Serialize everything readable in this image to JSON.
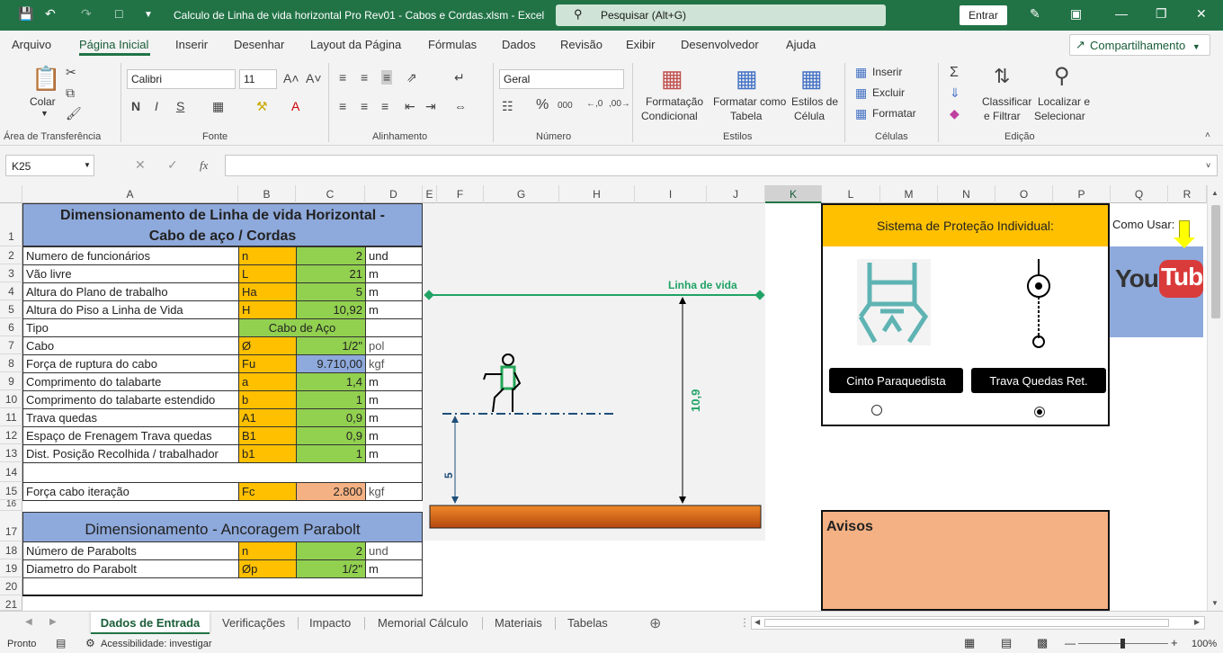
{
  "titlebar": {
    "file_title": "Calculo de Linha de vida horizontal  Pro Rev01 - Cabos e Cordas.xlsm  -  Excel",
    "search_placeholder": "Pesquisar (Alt+G)",
    "signin_label": "Entrar"
  },
  "menu": {
    "items": [
      "Arquivo",
      "Página Inicial",
      "Inserir",
      "Desenhar",
      "Layout da Página",
      "Fórmulas",
      "Dados",
      "Revisão",
      "Exibir",
      "Desenvolvedor",
      "Ajuda"
    ],
    "active": "Página Inicial",
    "share_label": "Compartilhamento"
  },
  "ribbon": {
    "clipboard": {
      "paste_label": "Colar",
      "group_label": "Área de Transferência"
    },
    "font": {
      "name": "Calibri",
      "size": "11",
      "bold": "N",
      "italic": "I",
      "underline": "S",
      "group_label": "Fonte"
    },
    "alignment": {
      "group_label": "Alinhamento"
    },
    "number": {
      "format": "Geral",
      "group_label": "Número"
    },
    "styles": {
      "conditional_l1": "Formatação",
      "conditional_l2": "Condicional",
      "table_l1": "Formatar como",
      "table_l2": "Tabela",
      "cell_l1": "Estilos de",
      "cell_l2": "Célula",
      "group_label": "Estilos"
    },
    "cells": {
      "insert": "Inserir",
      "delete": "Excluir",
      "format": "Formatar",
      "group_label": "Células"
    },
    "editing": {
      "sort_l1": "Classificar",
      "sort_l2": "e Filtrar",
      "find_l1": "Localizar e",
      "find_l2": "Selecionar",
      "group_label": "Edição"
    }
  },
  "formula_bar": {
    "name_box": "K25",
    "fx": "fx",
    "content": ""
  },
  "columns": [
    "A",
    "B",
    "C",
    "D",
    "E",
    "F",
    "G",
    "H",
    "I",
    "J",
    "K",
    "L",
    "M",
    "N",
    "O",
    "P",
    "Q",
    "R"
  ],
  "rows": [
    "1",
    "2",
    "3",
    "4",
    "5",
    "6",
    "7",
    "8",
    "9",
    "10",
    "11",
    "12",
    "13",
    "14",
    "15",
    "16",
    "17",
    "18",
    "19",
    "20",
    "21"
  ],
  "sheet": {
    "title_line1": "Dimensionamento de Linha de vida Horizontal -",
    "title_line2": "Cabo de aço  / Cordas",
    "inputs": [
      {
        "label": "Numero de funcionários",
        "sym": "n",
        "value": "2",
        "unit": "und"
      },
      {
        "label": "Vão livre",
        "sym": "L",
        "value": "21",
        "unit": "m"
      },
      {
        "label": "Altura do Plano de trabalho",
        "sym": "Ha",
        "value": "5",
        "unit": "m"
      },
      {
        "label": "Altura do Piso a Linha de Vida",
        "sym": "H",
        "value": "10,92",
        "unit": "m"
      }
    ],
    "tipo_label": "Tipo",
    "tipo_value": "Cabo de Aço",
    "cabo": {
      "label": "Cabo",
      "sym": "Ø",
      "value": "1/2\"",
      "unit": "pol"
    },
    "ruptura": {
      "label": "Força de ruptura do cabo",
      "sym": "Fu",
      "value": "9.710,00",
      "unit": "kgf"
    },
    "inputs2": [
      {
        "label": "Comprimento do talabarte",
        "sym": "a",
        "value": "1,4",
        "unit": "m"
      },
      {
        "label": "Comprimento do talabarte estendido",
        "sym": "b",
        "value": "1",
        "unit": "m"
      },
      {
        "label": "Trava quedas",
        "sym": "A1",
        "value": "0,9",
        "unit": "m"
      },
      {
        "label": "Espaço de Frenagem Trava quedas",
        "sym": "B1",
        "value": "0,9",
        "unit": "m"
      },
      {
        "label": "Dist. Posição Recolhida / trabalhador",
        "sym": "b1",
        "value": "1",
        "unit": "m"
      }
    ],
    "forca": {
      "label": "Força cabo iteração",
      "sym": "Fc",
      "value": "2.800",
      "unit": "kgf"
    },
    "ancoragem_title": "Dimensionamento - Ancoragem Parabolt",
    "parabolt": [
      {
        "label": "Número de Parabolts",
        "sym": "n",
        "value": "2",
        "unit": "und"
      },
      {
        "label": "Diametro do Parabolt",
        "sym": "Øp",
        "value": "1/2\"",
        "unit": "m"
      }
    ]
  },
  "drawing": {
    "lifeline_label": "Linha de vida",
    "height_label": "10,9",
    "work_height_label": "5"
  },
  "epi": {
    "title": "Sistema de Proteção Individual:",
    "option1": "Cinto Paraquedista",
    "option2": "Trava Quedas Ret.",
    "selected": "Trava Quedas Ret."
  },
  "how_to": {
    "label": "Como Usar:",
    "video_logo": "YouTube"
  },
  "avisos": {
    "title": "Avisos"
  },
  "tabs": {
    "items": [
      "Dados de Entrada",
      "Verificações",
      "Impacto",
      "Memorial Cálculo",
      "Materiais",
      "Tabelas"
    ],
    "active": "Dados de Entrada"
  },
  "status": {
    "ready": "Pronto",
    "accessibility": "Acessibilidade: investigar",
    "zoom": "100%"
  },
  "colors": {
    "excel_green": "#217346",
    "header_blue": "#8ea9db",
    "symbol_orange": "#ffc000",
    "value_green": "#92d050",
    "epi_yellow": "#ffc000",
    "avisos_peach": "#f4b183"
  }
}
